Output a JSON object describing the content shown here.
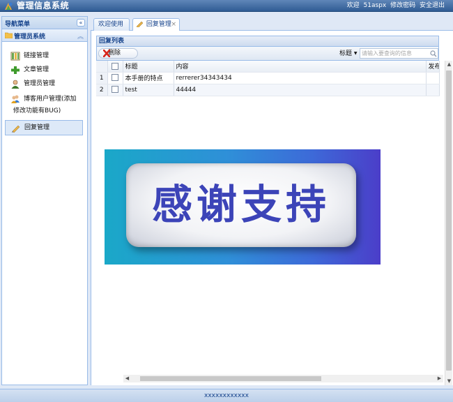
{
  "header": {
    "app_title": "管理信息系统",
    "welcome": "欢迎",
    "username": "51aspx",
    "change_password": "修改密码",
    "logout": "安全退出"
  },
  "nav": {
    "title": "导航菜单",
    "collapse_glyph": "«",
    "section_title": "管理员系统",
    "section_toggle_glyph": "︽",
    "items": [
      {
        "label": "链接管理",
        "icon": "columns-icon"
      },
      {
        "label": "文章管理",
        "icon": "add-icon"
      },
      {
        "label": "管理员管理",
        "icon": "user-icon"
      },
      {
        "label": "博客用户管理(添加修改功能有BUG)",
        "icon": "users-icon"
      },
      {
        "label": "回复管理",
        "icon": "pencil-icon"
      }
    ]
  },
  "tabs": [
    {
      "label": "欢迎使用"
    },
    {
      "label": "回复管理",
      "close": "×"
    }
  ],
  "grid": {
    "title": "回复列表",
    "delete_label": "删除",
    "search": {
      "field": "标题",
      "placeholder": "请输入要查询的信息"
    },
    "columns": [
      "标题",
      "内容",
      "发布"
    ],
    "rows": [
      {
        "num": "1",
        "title": "本手册的特点",
        "content": "rerrerer34343434"
      },
      {
        "num": "2",
        "title": "test",
        "content": "44444"
      }
    ]
  },
  "banner": {
    "text": "感谢支持"
  },
  "footer": {
    "text": "xxxxxxxxxxxx"
  },
  "colors": {
    "header": "#2f5c94",
    "panel_border": "#99bbe8",
    "title_text": "#15428b",
    "banner_text": "#3c44b8"
  }
}
